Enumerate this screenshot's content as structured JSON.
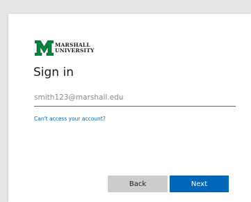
{
  "logo": {
    "line1": "MARSHALL",
    "line2": "UNIVERSITY",
    "icon": "marshall-m-logo",
    "color": "#00833e"
  },
  "title": "Sign in",
  "email_field": {
    "value": "smith123@marshall.edu",
    "placeholder": ""
  },
  "links": {
    "cant_access": "Can't access your account?"
  },
  "buttons": {
    "back": "Back",
    "next": "Next"
  },
  "colors": {
    "accent": "#0067b8",
    "brand_green": "#00833e",
    "back_button": "#cccccc"
  }
}
